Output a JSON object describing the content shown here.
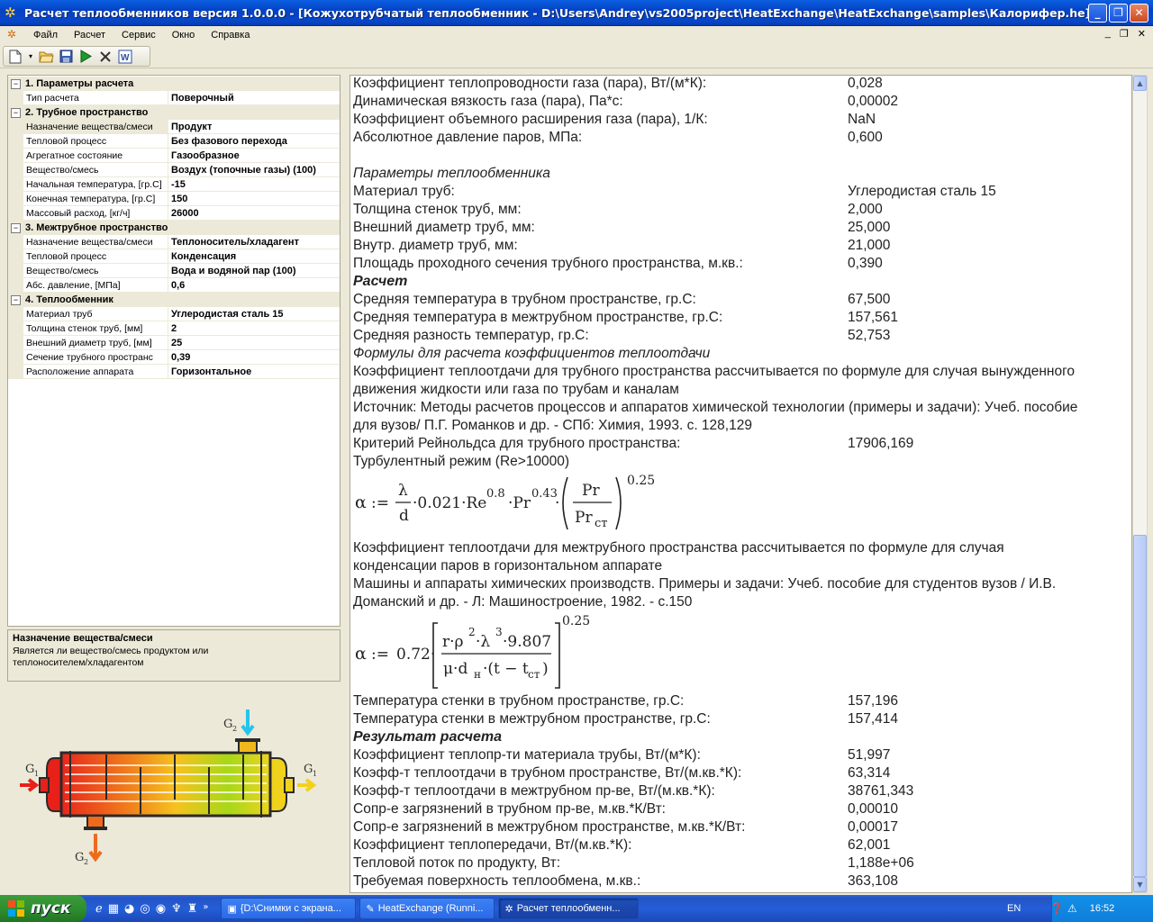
{
  "window": {
    "title": "Расчет теплообменников версия 1.0.0.0 - [Кожухотрубчатый теплообменник - D:\\Users\\Andrey\\vs2005project\\HeatExchange\\HeatExchange\\samples\\Калорифер.he]"
  },
  "menu": [
    "Файл",
    "Расчет",
    "Сервис",
    "Окно",
    "Справка"
  ],
  "properties": {
    "cat1": "1. Параметры расчета",
    "cat2": "2. Трубное пространство",
    "cat3": "3. Межтрубное пространство",
    "cat4": "4. Теплообменник",
    "rows1": [
      {
        "name": "Тип расчета",
        "value": "Поверочный"
      }
    ],
    "rows2": [
      {
        "name": "Назначение вещества/смеси",
        "value": "Продукт"
      },
      {
        "name": "Тепловой процесс",
        "value": "Без фазового перехода"
      },
      {
        "name": "Агрегатное состояние",
        "value": "Газообразное"
      },
      {
        "name": "Вещество/смесь",
        "value": "Воздух (топочные газы) (100)"
      },
      {
        "name": "Начальная температура, [гр.С]",
        "value": "-15"
      },
      {
        "name": "Конечная температура, [гр.С]",
        "value": "150"
      },
      {
        "name": "Массовый расход, [кг/ч]",
        "value": "26000"
      }
    ],
    "rows3": [
      {
        "name": "Назначение вещества/смеси",
        "value": "Теплоноситель/хладагент"
      },
      {
        "name": "Тепловой процесс",
        "value": "Конденсация"
      },
      {
        "name": "Вещество/смесь",
        "value": "Вода и водяной пар (100)"
      },
      {
        "name": "Абс. давление, [МПа]",
        "value": "0,6"
      }
    ],
    "rows4": [
      {
        "name": "Материал труб",
        "value": "Углеродистая сталь 15"
      },
      {
        "name": "Толщина стенок труб, [мм]",
        "value": "2"
      },
      {
        "name": "Внешний диаметр труб, [мм]",
        "value": "25"
      },
      {
        "name": "Сечение трубного пространс",
        "value": "0,39"
      },
      {
        "name": "Расположение аппарата",
        "value": "Горизонтальное"
      }
    ]
  },
  "description": {
    "title": "Назначение вещества/смеси",
    "text": "Является ли вещество/смесь продуктом или теплоносителем/хладагентом"
  },
  "diagram": {
    "g1_left": "G",
    "g1_left_sub": "1",
    "g1_right": "G",
    "g1_right_sub": "1",
    "g2_top": "G",
    "g2_top_sub": "2",
    "g2_bottom": "G",
    "g2_bottom_sub": "2"
  },
  "report": {
    "lines": [
      {
        "t": "Коэффициент теплопроводности газа (пара), Вт/(м*К):",
        "v": "0,028"
      },
      {
        "t": "Динамическая вязкость газа (пара), Па*с:",
        "v": "0,00002"
      },
      {
        "t": "Коэффициент объемного расширения газа (пара), 1/К:",
        "v": "NaN"
      },
      {
        "t": "Абсолютное давление паров, МПа:",
        "v": "0,600"
      },
      {
        "t": "Параметры теплообменника",
        "v": ""
      },
      {
        "t": "Материал труб:",
        "v": "Углеродистая сталь 15"
      },
      {
        "t": "Толщина стенок труб, мм:",
        "v": "2,000"
      },
      {
        "t": "Внешний диаметр труб, мм:",
        "v": "25,000"
      },
      {
        "t": "Внутр. диаметр труб, мм:",
        "v": "21,000"
      },
      {
        "t": "Площадь проходного сечения трубного пространства, м.кв.:",
        "v": "0,390"
      },
      {
        "t": "Расчет",
        "v": ""
      },
      {
        "t": "Средняя температура в трубном пространстве, гр.С:",
        "v": "67,500"
      },
      {
        "t": "Средняя температура в межтрубном пространстве, гр.С:",
        "v": "157,561"
      },
      {
        "t": "Средняя разность температур, гр.С:",
        "v": "52,753"
      },
      {
        "t": "Формулы для расчета коэффициентов теплоотдачи",
        "v": ""
      },
      {
        "t": "Коэффициент теплоотдачи для трубного пространства рассчитывается по формуле для случая вынужденного",
        "v": ""
      },
      {
        "t": "движения жидкости или газа по трубам и каналам",
        "v": ""
      },
      {
        "t": "Источник: Методы расчетов процессов и аппаратов химической технологии (примеры и задачи): Учеб. пособие",
        "v": ""
      },
      {
        "t": "для вузов/ П.Г. Романков и др. - СПб: Химия, 1993.  с. 128,129",
        "v": ""
      },
      {
        "t": "Критерий Рейнольдса для трубного пространства:",
        "v": "17906,169"
      },
      {
        "t": "Турбулентный режим (Re>10000)",
        "v": ""
      },
      {
        "t": "Коэффициент теплоотдачи для межтрубного пространства рассчитывается по формуле для случая",
        "v": ""
      },
      {
        "t": "конденсации паров в горизонтальном аппарате",
        "v": ""
      },
      {
        "t": "Машины и аппараты химических производств. Примеры и задачи: Учеб. пособие для студентов вузов / И.В.",
        "v": ""
      },
      {
        "t": "Доманский и др. - Л: Машиностроение, 1982. - с.150",
        "v": ""
      },
      {
        "t": "Температура стенки в трубном пространстве, гр.С:",
        "v": "157,196"
      },
      {
        "t": "Температура стенки в межтрубном пространстве, гр.С:",
        "v": "157,414"
      },
      {
        "t": "Результат расчета",
        "v": ""
      },
      {
        "t": "Коэффициент теплопр-ти материала трубы, Вт/(м*К):",
        "v": "51,997"
      },
      {
        "t": "Коэфф-т теплоотдачи в трубном пространстве, Вт/(м.кв.*К):",
        "v": "63,314"
      },
      {
        "t": "Коэфф-т теплоотдачи в межтрубном пр-ве, Вт/(м.кв.*К):",
        "v": "38761,343"
      },
      {
        "t": "Сопр-е загрязнений в трубном пр-ве, м.кв.*К/Вт:",
        "v": "0,00010"
      },
      {
        "t": "Сопр-е загрязнений в межтрубном пространстве, м.кв.*К/Вт:",
        "v": "0,00017"
      },
      {
        "t": "Коэффициент теплопередачи, Вт/(м.кв.*К):",
        "v": "62,001"
      },
      {
        "t": "Тепловой поток по продукту, Вт:",
        "v": "1,188e+06"
      },
      {
        "t": "Требуемая поверхность теплообмена, м.кв.:",
        "v": "363,108"
      }
    ],
    "formula1": {
      "alpha": "α",
      "assign": ":=",
      "num": "λ",
      "den": "d",
      "coef": "·0.021·Re",
      "re_exp": "0.8",
      "pr": "·Pr",
      "pr_exp": "0.43",
      "dot": "·",
      "fr_num": "Pr",
      "fr_den": "Pr",
      "fr_den_sub": "ст",
      "exp": "0.25"
    },
    "formula2": {
      "alpha": "α",
      "assign": ":=",
      "coef": "0.72·",
      "num_a": "r·ρ",
      "num_sup1": "2",
      "num_b": "·λ",
      "num_sup2": "3",
      "num_c": "·9.807",
      "den_a": "μ·d",
      "den_sub": "н",
      "den_b": "·(t − t",
      "den_sub2": "ст",
      "den_c": ")",
      "exp": "0.25"
    }
  },
  "taskbar": {
    "start": "пуск",
    "tasks": [
      "{D:\\Снимки с экрана...",
      "HeatExchange (Runni...",
      "Расчет теплообменн..."
    ],
    "lang": "EN",
    "clock": "16:52"
  },
  "colors": {
    "titlebar": "#0846c8",
    "accent_green": "#2f8f2f",
    "report_text": "#222222"
  }
}
